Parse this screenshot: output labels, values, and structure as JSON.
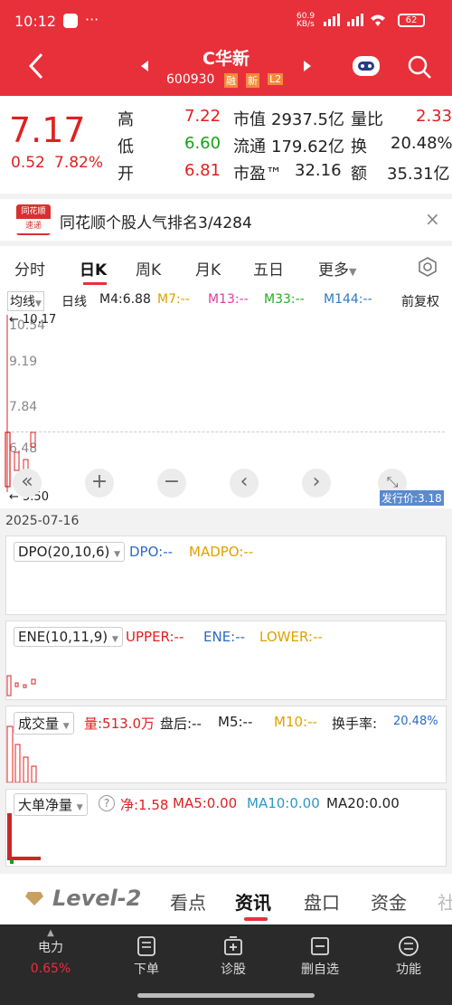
{
  "status_bar": {
    "time": "10:12",
    "dots": "···",
    "net_speed": "60.9 KB/s",
    "signal1": "4G HD",
    "battery": "62"
  },
  "header": {
    "name": "C华新",
    "code": "600930",
    "badges": [
      "融",
      "新",
      "L2"
    ]
  },
  "quote": {
    "price": "7.17",
    "change": "0.52",
    "change_pct": "7.82%",
    "rows": [
      {
        "l1": "高",
        "v1": "7.22",
        "l2": "市值",
        "v2": "2937.5亿",
        "l3": "量比",
        "v3": "2.33"
      },
      {
        "l1": "低",
        "v1": "6.60",
        "l2": "流通",
        "v2": "179.62亿",
        "l3": "换",
        "v3": "20.48%"
      },
      {
        "l1": "开",
        "v1": "6.81",
        "l2": "市盈™",
        "v2": "32.16",
        "l3": "额",
        "v3": "35.31亿"
      }
    ],
    "colors": {
      "up": "#e02020",
      "down": "#19a01a"
    }
  },
  "rank": {
    "logo_top": "同花顺",
    "logo_bottom": "速递",
    "text": "同花顺个股人气排名3/4284"
  },
  "tabs": [
    "分时",
    "日K",
    "周K",
    "月K",
    "五日",
    "更多"
  ],
  "chart": {
    "ma_select": "均线",
    "period": "日线",
    "m4": "M4:6.88",
    "m7": "M7:--",
    "m13": "M13:--",
    "m33": "M33:--",
    "m144": "M144:--",
    "adjust": "前复权",
    "y_labels": [
      "10.54",
      "9.19",
      "7.84",
      "6.48"
    ],
    "high_mark": "10.17",
    "low_mark": "5.50",
    "issue_price": "发行价:3.18"
  },
  "date": "2025-07-16",
  "dpo": {
    "select": "DPO(20,10,6)",
    "dpo": "DPO:--",
    "madpo": "MADPO:--"
  },
  "ene": {
    "select": "ENE(10,11,9)",
    "upper": "UPPER:--",
    "ene": "ENE:--",
    "lower": "LOWER:--"
  },
  "volume": {
    "select": "成交量",
    "vol": "量:513.0万",
    "after": "盘后:--",
    "m5": "M5:--",
    "m10": "M10:--",
    "turnover_label": "换手率:",
    "turnover": "20.48%"
  },
  "bigorder": {
    "select": "大单净量",
    "net": "净:1.58",
    "ma5": "MA5:0.00",
    "ma10": "MA10:0.00",
    "ma20": "MA20:0.00"
  },
  "bottom_tabs": [
    "Level-2",
    "看点",
    "资讯",
    "盘口",
    "资金",
    "社"
  ],
  "nav": {
    "power_label": "电力",
    "power_pct": "0.65%",
    "items": [
      "下单",
      "诊股",
      "删自选",
      "功能"
    ]
  }
}
